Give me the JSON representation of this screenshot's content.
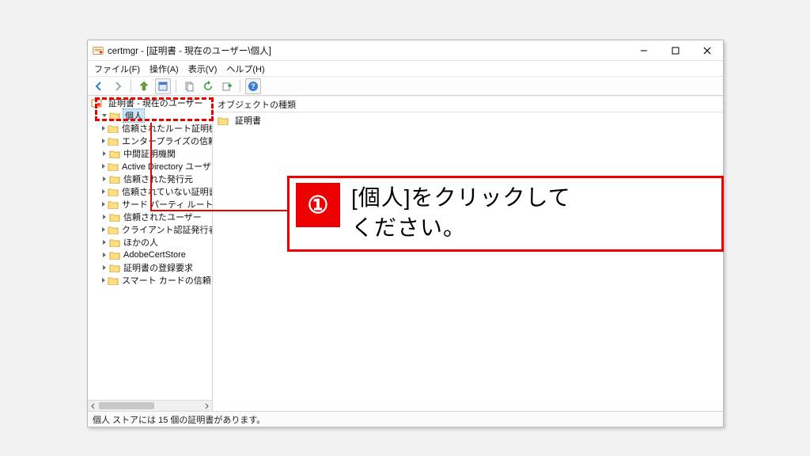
{
  "window": {
    "title": "certmgr - [証明書 - 現在のユーザー\\個人]",
    "min_tooltip": "最小化",
    "max_tooltip": "最大化",
    "close_tooltip": "閉じる"
  },
  "menu": {
    "file": "ファイル(F)",
    "action": "操作(A)",
    "view": "表示(V)",
    "help": "ヘルプ(H)"
  },
  "toolbar": {
    "back": "戻る",
    "forward": "進む",
    "up": "上へ",
    "props": "プロパティ",
    "copy": "コピー",
    "refresh": "更新",
    "export": "エクスポート",
    "help": "ヘルプ"
  },
  "tree": {
    "root": "証明書 - 現在のユーザー",
    "items": [
      {
        "label": "個人",
        "selected": true,
        "expanded": true
      },
      {
        "label": "信頼されたルート証明機関"
      },
      {
        "label": "エンタープライズの信頼"
      },
      {
        "label": "中間証明機関"
      },
      {
        "label": "Active Directory ユーザー オブジ"
      },
      {
        "label": "信頼された発行元"
      },
      {
        "label": "信頼されていない証明書"
      },
      {
        "label": "サード パーティ ルート証明機関"
      },
      {
        "label": "信頼されたユーザー"
      },
      {
        "label": "クライアント認証発行者"
      },
      {
        "label": "ほかの人"
      },
      {
        "label": "AdobeCertStore"
      },
      {
        "label": "証明書の登録要求"
      },
      {
        "label": "スマート カードの信頼されたルート"
      }
    ]
  },
  "content": {
    "column_header": "オブジェクトの種類",
    "items": [
      {
        "label": "証明書"
      }
    ]
  },
  "status": "個人 ストアには 15 個の証明書があります。",
  "annotation": {
    "number": "①",
    "text_line1": "[個人]をクリックして",
    "text_line2": "ください。"
  }
}
